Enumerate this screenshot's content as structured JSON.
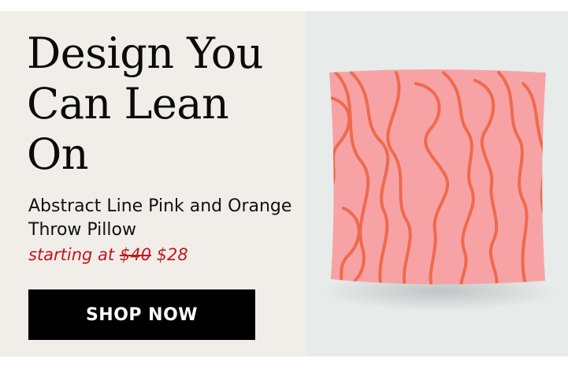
{
  "promo": {
    "headline": "Design You Can Lean On",
    "product_name": "Abstract Line Pink and Orange Throw Pillow",
    "price_prefix": "starting at",
    "old_price": "$40",
    "new_price": "$28",
    "cta_label": "SHOP NOW"
  },
  "colors": {
    "left_background": "#f1eeea",
    "right_background": "#e7ebea",
    "price_red": "#c4161c",
    "button_black": "#000000",
    "pillow_pink": "#f7a3a6",
    "line_orange": "#ef6a4d"
  },
  "image": {
    "subject": "pink-throw-pillow-with-orange-abstract-lines"
  }
}
